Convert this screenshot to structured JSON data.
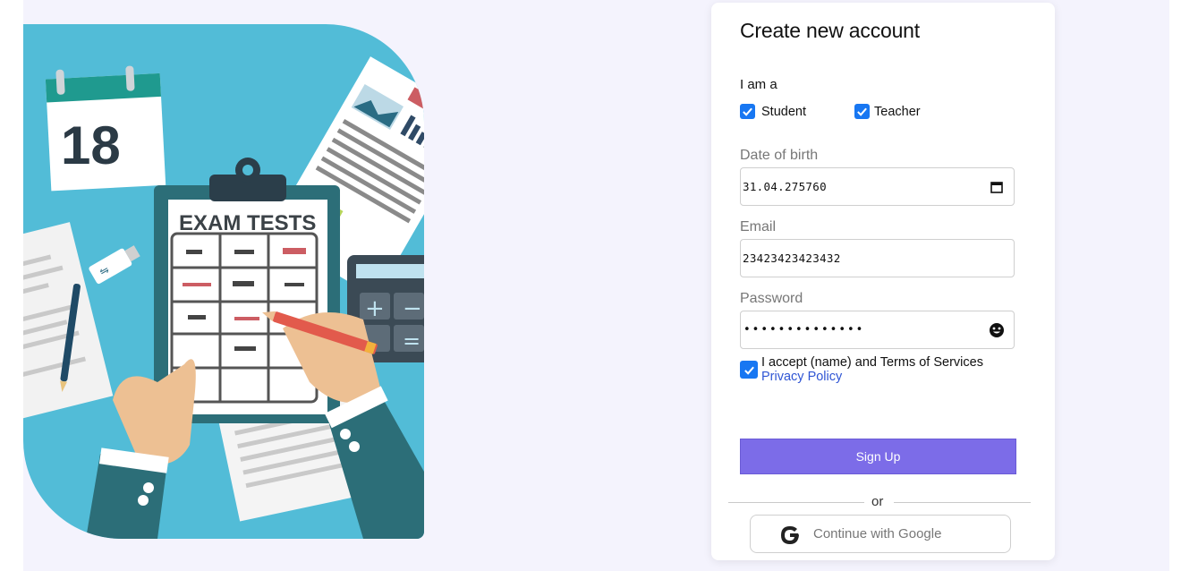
{
  "form": {
    "title": "Create new account",
    "role_label": "I am a",
    "roles": [
      {
        "label": "Student",
        "checked": true
      },
      {
        "label": "Teacher",
        "checked": true
      }
    ],
    "dob": {
      "label": "Date of birth",
      "value": "31.04.275760"
    },
    "email": {
      "label": "Email",
      "value": "23423423423432"
    },
    "password": {
      "label": "Password",
      "masked_value": "••••••••••••••",
      "toggle_icon": "smiley-face-icon"
    },
    "terms": {
      "text": "I accept (name) and Terms of Services",
      "link": "Privacy Policy",
      "checked": true
    },
    "signup_label": "Sign Up",
    "divider_text": "or",
    "google_label": "Continue with Google"
  },
  "hero": {
    "calendar_day": "18",
    "clipboard_title": "EXAM TESTS"
  },
  "colors": {
    "accent": "#7c6ce8",
    "checkbox": "#1877f2",
    "link": "#2f55d4",
    "hero_background": "#52bcd7",
    "page_background": "#f4f3fd"
  }
}
